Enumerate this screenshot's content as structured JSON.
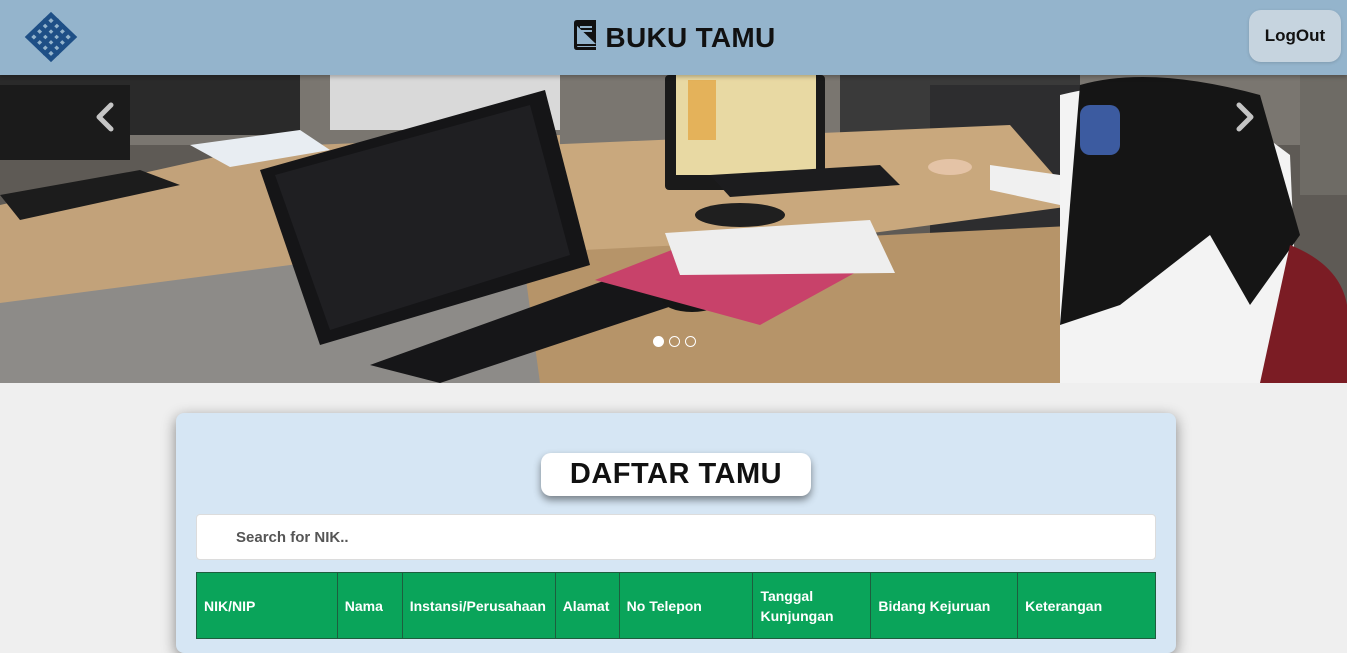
{
  "header": {
    "title": "BUKU TAMU",
    "logout_label": "LogOut",
    "logo_icon": "kemnaker-logo-icon",
    "book_icon": "book-icon",
    "background": "#94b4cc"
  },
  "carousel": {
    "prev_icon": "chevron-left-icon",
    "next_icon": "chevron-right-icon",
    "slide_count": 3,
    "active_slide": 1
  },
  "main": {
    "title": "DAFTAR TAMU",
    "search_placeholder": "Search for NIK..",
    "table_headers": [
      "NIK/NIP",
      "Nama",
      "Instansi/Perusahaan",
      "Alamat",
      "No Telepon",
      "Tanggal Kunjungan",
      "Bidang Kejuruan",
      "Keterangan"
    ],
    "header_color": "#0aa45a"
  }
}
